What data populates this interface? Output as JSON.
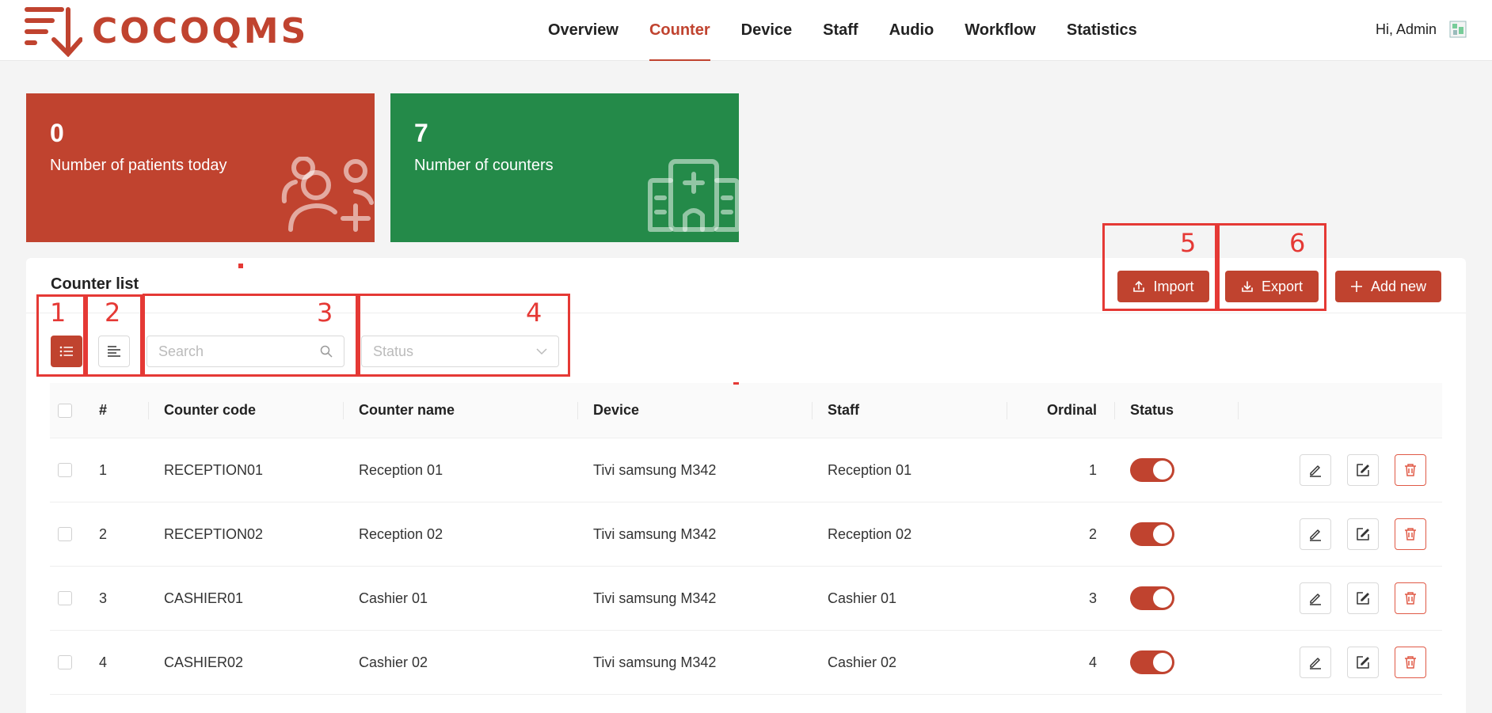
{
  "header": {
    "logo_text": "COCOQMS",
    "nav": [
      "Overview",
      "Counter",
      "Device",
      "Staff",
      "Audio",
      "Workflow",
      "Statistics"
    ],
    "active_nav": "Counter",
    "greeting": "Hi, Admin"
  },
  "stats": [
    {
      "value": "0",
      "label": "Number of patients today",
      "color": "#c0432f",
      "icon": "patients-icon"
    },
    {
      "value": "7",
      "label": "Number of counters",
      "color": "#248a49",
      "icon": "hospital-icon"
    }
  ],
  "panel": {
    "title": "Counter list",
    "import_label": "Import",
    "export_label": "Export",
    "add_label": "Add new"
  },
  "filters": {
    "search_placeholder": "Search",
    "status_placeholder": "Status"
  },
  "table": {
    "columns": [
      "#",
      "Counter code",
      "Counter name",
      "Device",
      "Staff",
      "Ordinal",
      "Status"
    ],
    "rows": [
      {
        "num": "1",
        "code": "RECEPTION01",
        "name": "Reception 01",
        "device": "Tivi samsung M342",
        "staff": "Reception 01",
        "ordinal": "1",
        "status": true
      },
      {
        "num": "2",
        "code": "RECEPTION02",
        "name": "Reception 02",
        "device": "Tivi samsung M342",
        "staff": "Reception 02",
        "ordinal": "2",
        "status": true
      },
      {
        "num": "3",
        "code": "CASHIER01",
        "name": "Cashier 01",
        "device": "Tivi samsung M342",
        "staff": "Cashier 01",
        "ordinal": "3",
        "status": true
      },
      {
        "num": "4",
        "code": "CASHIER02",
        "name": "Cashier 02",
        "device": "Tivi samsung M342",
        "staff": "Cashier 02",
        "ordinal": "4",
        "status": true
      }
    ]
  },
  "annotations": [
    "1",
    "2",
    "3",
    "4",
    "5",
    "6"
  ],
  "colors": {
    "accent": "#c0432f",
    "green": "#248a49",
    "annotation": "#e53935"
  }
}
